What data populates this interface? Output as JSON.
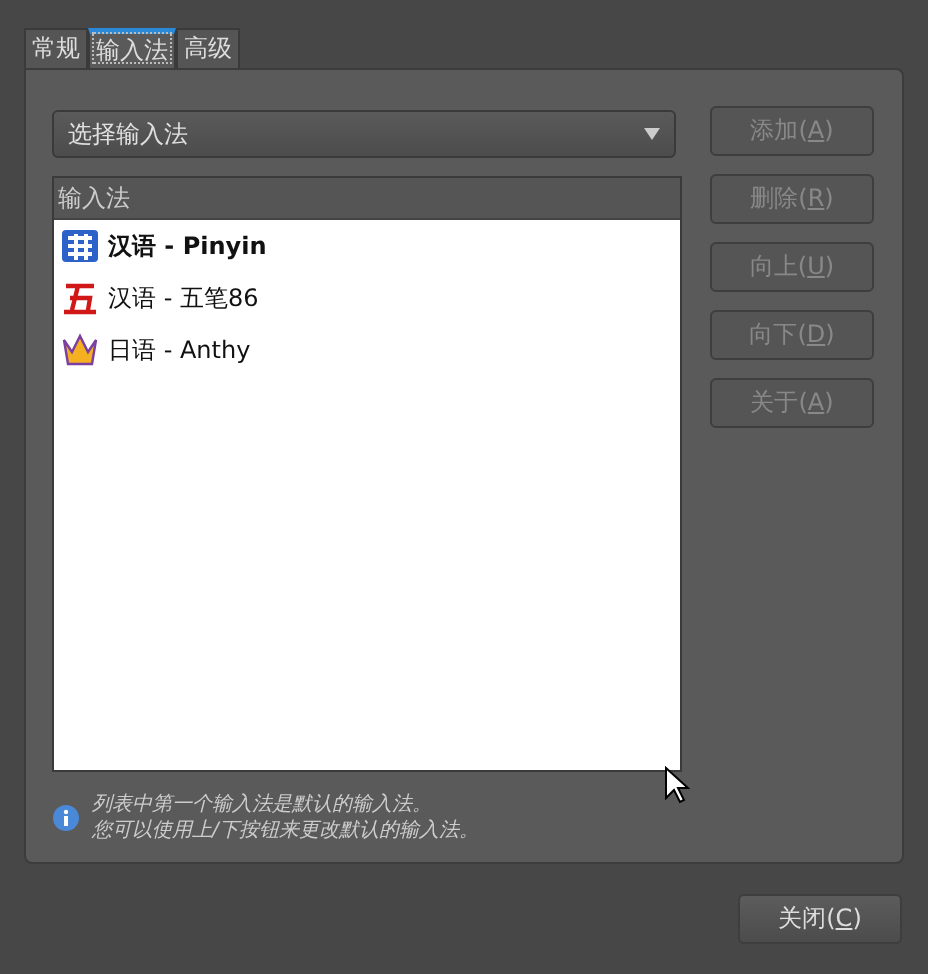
{
  "tabs": [
    {
      "label": "常规",
      "selected": false
    },
    {
      "label": "输入法",
      "selected": true
    },
    {
      "label": "高级",
      "selected": false
    }
  ],
  "dropdown": {
    "value": "选择输入法"
  },
  "list": {
    "header": "输入法",
    "items": [
      {
        "kind": "pinyin",
        "label": "汉语 - Pinyin",
        "default": true
      },
      {
        "kind": "wubi",
        "label": "汉语 - 五笔86",
        "default": false
      },
      {
        "kind": "crown",
        "label": "日语 - Anthy",
        "default": false
      }
    ]
  },
  "buttons": [
    {
      "label": "添加(",
      "mnemonic": "A",
      "suffix": ")",
      "disabled": true
    },
    {
      "label": "删除(",
      "mnemonic": "R",
      "suffix": ")",
      "disabled": true
    },
    {
      "label": "向上(",
      "mnemonic": "U",
      "suffix": ")",
      "disabled": true
    },
    {
      "label": "向下(",
      "mnemonic": "D",
      "suffix": ")",
      "disabled": true
    },
    {
      "label": "关于(",
      "mnemonic": "A",
      "suffix": ")",
      "disabled": true
    }
  ],
  "info": [
    "列表中第一个输入法是默认的输入法。",
    "您可以使用上/下按钮来更改默认的输入法。"
  ],
  "close_button": {
    "label": "关闭(",
    "mnemonic": "C",
    "suffix": ")",
    "disabled": false
  }
}
